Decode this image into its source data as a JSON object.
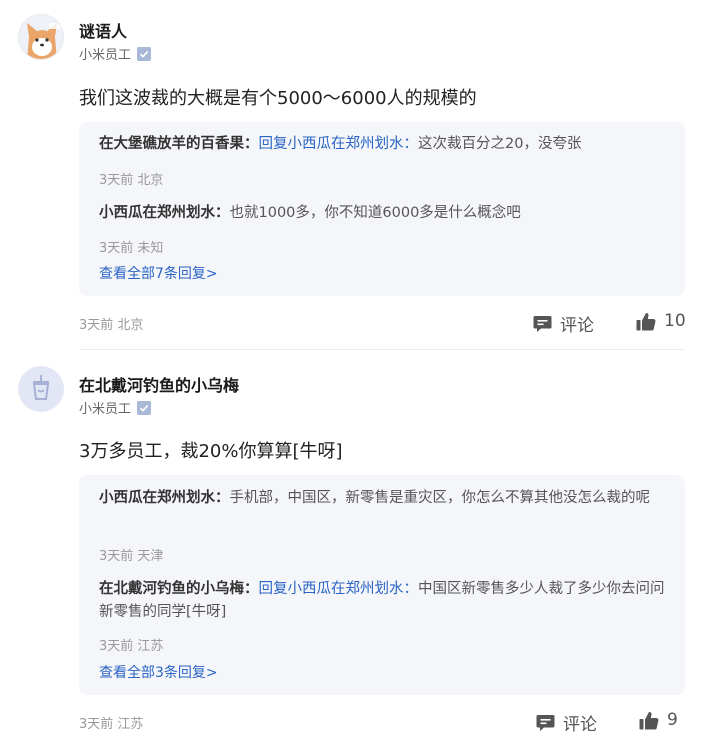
{
  "comments": [
    {
      "author": "谜语人",
      "role": "小米员工",
      "content": "我们这波裁的大概是有个5000～6000人的规模的",
      "replies": [
        {
          "author": "在大堡礁放羊的百香果",
          "reply_prefix": "回复",
          "reply_to": "小西瓜在郑州划水",
          "text": "这次裁百分之20，没夸张",
          "meta": "3天前 北京"
        },
        {
          "author": "小西瓜在郑州划水",
          "text": "也就1000多，你不知道6000多是什么概念吧",
          "meta": "3天前 未知"
        }
      ],
      "more_label": "查看全部7条回复>",
      "meta": "3天前 北京",
      "comment_label": "评论",
      "likes": "10"
    },
    {
      "author": "在北戴河钓鱼的小乌梅",
      "role": "小米员工",
      "content": "3万多员工，裁20%你算算[牛呀]",
      "replies": [
        {
          "author": "小西瓜在郑州划水",
          "text": "手机部，中国区，新零售是重灾区，你怎么不算其他没怎么裁的呢",
          "meta": "3天前 天津"
        },
        {
          "author": "在北戴河钓鱼的小乌梅",
          "reply_prefix": "回复",
          "reply_to": "小西瓜在郑州划水",
          "text": "中国区新零售多少人裁了多少你去问问新零售的同学[牛呀]",
          "meta": "3天前 江苏"
        }
      ],
      "more_label": "查看全部3条回复>",
      "meta": "3天前 江苏",
      "comment_label": "评论",
      "likes": "9"
    }
  ],
  "icons": {
    "verified": "verified-badge-icon",
    "comment": "comment-bubble-icon",
    "like": "thumbs-up-icon"
  },
  "colors": {
    "link": "#2a64c5",
    "reply_bg": "#f5f6fa",
    "meta": "#999999"
  }
}
